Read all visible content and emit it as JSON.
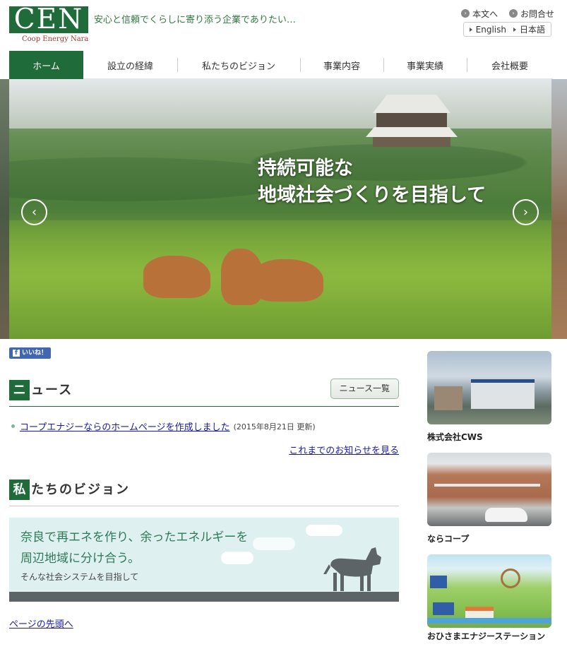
{
  "header": {
    "logo_text": "CEN",
    "logo_sub": "Coop Energy Nara",
    "tagline": "安心と信頼でくらしに寄り添う企業でありたい…",
    "util_links": [
      "本文へ",
      "お問合せ"
    ],
    "languages": [
      "English",
      "日本語"
    ]
  },
  "nav": {
    "items": [
      "ホーム",
      "設立の経緯",
      "私たちのビジョン",
      "事業内容",
      "事業実績",
      "会社概要"
    ],
    "active_index": 0
  },
  "hero": {
    "title_line1": "持続可能な",
    "title_line2": "地域社会づくりを目指して",
    "prev_icon": "chevron-left-icon",
    "next_icon": "chevron-right-icon"
  },
  "facebook": {
    "like_label": "いいね！"
  },
  "news": {
    "heading_initial": "ニ",
    "heading_rest": "ュース",
    "list_button": "ニュース一覧",
    "items": [
      {
        "title": "コープエナジーならのホームページを作成しました",
        "date": "(2015年8月21日 更新)"
      }
    ],
    "more_link": "これまでのお知らせを見る"
  },
  "vision": {
    "heading_initial": "私",
    "heading_rest": "たちのビジョン",
    "banner_line1": "奈良で再エネを作り、余ったエネルギーを",
    "banner_line2": "周辺地域に分け合う。",
    "banner_line3": "そんな社会システムを目指して"
  },
  "page_top": "ページの先頭へ",
  "sidebar": [
    {
      "label": "株式会社CWS"
    },
    {
      "label": "ならコープ"
    },
    {
      "label": "おひさまエナジーステーション"
    }
  ],
  "colors": {
    "brand_green": "#1f6b3a",
    "link": "#1a1aa8"
  }
}
